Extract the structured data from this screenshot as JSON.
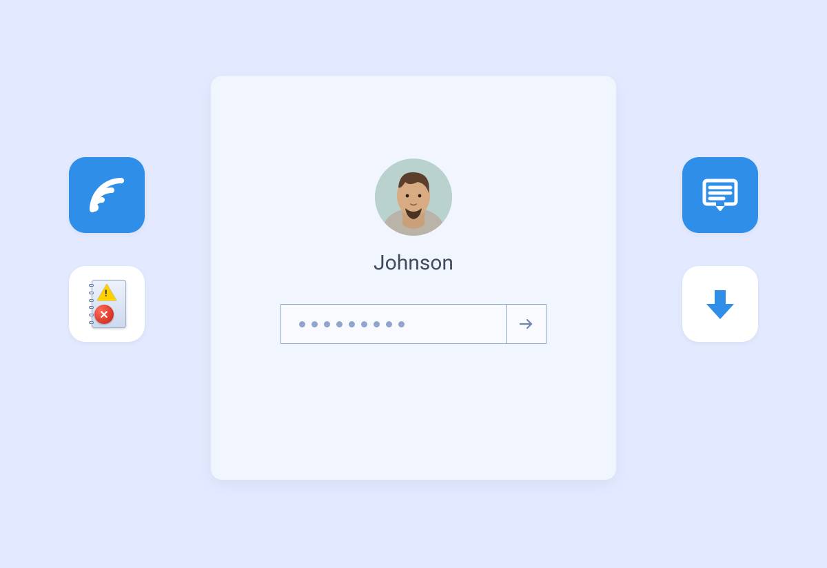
{
  "login": {
    "username": "Johnson",
    "password_dot_count": 9
  },
  "left_icons": [
    {
      "name": "wifi-icon",
      "bg": "blue"
    },
    {
      "name": "error-log-icon",
      "bg": "white"
    }
  ],
  "right_icons": [
    {
      "name": "comment-icon",
      "bg": "blue"
    },
    {
      "name": "download-icon",
      "bg": "white"
    }
  ],
  "colors": {
    "accent_blue": "#2f8fe8",
    "card_bg": "#f1f5fd",
    "page_bg": "#e3eaff",
    "border": "#90a8d0",
    "dot": "#8fa6cc",
    "text": "#3f4b5b"
  }
}
